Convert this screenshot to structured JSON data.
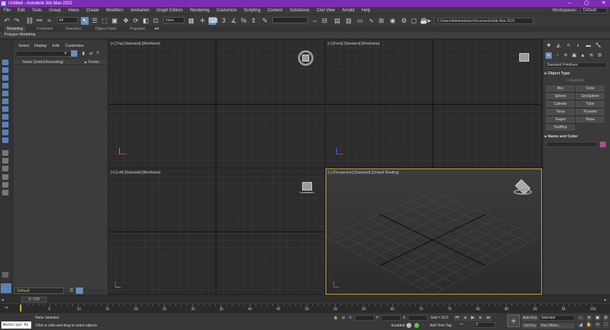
{
  "title_bar": {
    "title": "Untitled - Autodesk 3ds Max 2022"
  },
  "menu": {
    "items": [
      "File",
      "Edit",
      "Tools",
      "Group",
      "Views",
      "Create",
      "Modifiers",
      "Animation",
      "Graph Editors",
      "Rendering",
      "Customize",
      "Scripting",
      "Content",
      "Substance",
      "Civil View",
      "Arnold",
      "Help"
    ],
    "workspaces_label": "Workspaces:",
    "workspaces_value": "Default"
  },
  "toolbar": {
    "selection_filter": "All",
    "reference_coordinate": "View",
    "project_path": "C:\\Users\\Administrator\\Documents\\3ds Max 2022"
  },
  "ribbon": {
    "tabs": [
      "Modeling",
      "Freeform",
      "Selection",
      "Object Paint",
      "Populate"
    ],
    "active_tab": "Modeling",
    "panel": "Polygon Modeling"
  },
  "scene_explorer": {
    "menus": [
      "Select",
      "Display",
      "Edit",
      "Customize"
    ],
    "column_name": "Name (Sorted Ascending)",
    "column_frozen": "▲ Frozen",
    "layer_value": "Default"
  },
  "viewports": {
    "top": "[+] [Top] [Standard] [Wireframe]",
    "front": "[+] [Front] [Standard] [Wireframe]",
    "left": "[+] [Left] [Standard] [Wireframe]",
    "perspective": "[+] [Perspective] [Standard] [Default Shading]"
  },
  "command_panel": {
    "category": "Standard Primitives",
    "object_type_title": "Object Type",
    "autogrid": "AutoGrid",
    "buttons": [
      "Box",
      "Cone",
      "Sphere",
      "GeoSphere",
      "Cylinder",
      "Tube",
      "Torus",
      "Pyramid",
      "Teapot",
      "Plane",
      "TextPlus"
    ],
    "name_color_title": "Name and Color",
    "swatch_color": "#d4389a"
  },
  "time_slider": {
    "value": "0 / 100"
  },
  "track_bar": {
    "ticks": [
      "0",
      "5",
      "10",
      "15",
      "20",
      "25",
      "30",
      "35",
      "40",
      "45",
      "50",
      "55",
      "60",
      "65",
      "70",
      "75",
      "80",
      "85",
      "90",
      "95",
      "100"
    ]
  },
  "status": {
    "maxscript": "MAXScript Mi",
    "none_selected": "None Selected",
    "prompt": "Click or click-and-drag to select objects",
    "x_label": "X:",
    "y_label": "Y:",
    "z_label": "Z:",
    "grid": "Grid = 10.0",
    "enabled_label": "Enabled:",
    "add_time_tag": "Add Time Tag",
    "auto_key": "Auto Key",
    "set_key": "Set Key",
    "selected": "Selected",
    "key_filters": "Key Filters...",
    "frame": "0"
  },
  "colors": {
    "title_bar": "#7a2fb3",
    "accent": "#6a8fb8",
    "active_viewport_border": "#c9a227"
  }
}
